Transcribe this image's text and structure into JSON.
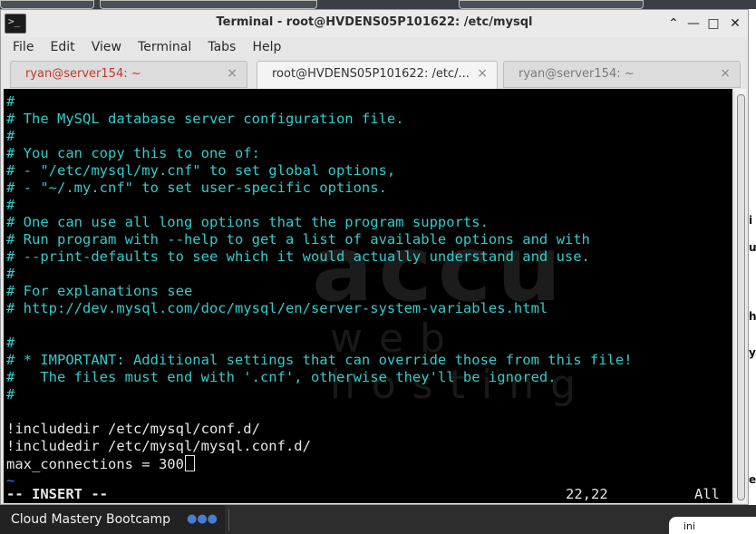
{
  "window": {
    "title": "Terminal - root@HVDENS05P101622: /etc/mysql",
    "menu": [
      "File",
      "Edit",
      "View",
      "Terminal",
      "Tabs",
      "Help"
    ],
    "tabs": [
      {
        "label": "ryan@server154: ~",
        "active": false,
        "color": "#c0392b"
      },
      {
        "label": "root@HVDENS05P101622: /etc/...",
        "active": true,
        "color": "#333333"
      },
      {
        "label": "ryan@server154: ~",
        "active": false,
        "color": "#7a7a7a"
      }
    ]
  },
  "terminal": {
    "watermark_text": "accu",
    "watermark_sub": "web hosting",
    "lines": [
      {
        "text": "#",
        "kind": "comment"
      },
      {
        "text": "# The MySQL database server configuration file.",
        "kind": "comment"
      },
      {
        "text": "#",
        "kind": "comment"
      },
      {
        "text": "# You can copy this to one of:",
        "kind": "comment"
      },
      {
        "text": "# - \"/etc/mysql/my.cnf\" to set global options,",
        "kind": "comment"
      },
      {
        "text": "# - \"~/.my.cnf\" to set user-specific options.",
        "kind": "comment"
      },
      {
        "text": "#",
        "kind": "comment"
      },
      {
        "text": "# One can use all long options that the program supports.",
        "kind": "comment"
      },
      {
        "text": "# Run program with --help to get a list of available options and with",
        "kind": "comment"
      },
      {
        "text": "# --print-defaults to see which it would actually understand and use.",
        "kind": "comment"
      },
      {
        "text": "#",
        "kind": "comment"
      },
      {
        "text": "# For explanations see",
        "kind": "comment"
      },
      {
        "text": "# http://dev.mysql.com/doc/mysql/en/server-system-variables.html",
        "kind": "comment"
      },
      {
        "text": "",
        "kind": "blank"
      },
      {
        "text": "#",
        "kind": "comment"
      },
      {
        "text": "# * IMPORTANT: Additional settings that can override those from this file!",
        "kind": "comment"
      },
      {
        "text": "#   The files must end with '.cnf', otherwise they'll be ignored.",
        "kind": "comment"
      },
      {
        "text": "#",
        "kind": "comment"
      },
      {
        "text": "",
        "kind": "blank"
      },
      {
        "text": "!includedir /etc/mysql/conf.d/",
        "kind": "plain"
      },
      {
        "text": "!includedir /etc/mysql/mysql.conf.d/",
        "kind": "plain"
      },
      {
        "text": "max_connections = 300",
        "kind": "cursor"
      },
      {
        "text": "~",
        "kind": "tilde"
      }
    ],
    "status": {
      "mode": "-- INSERT --",
      "position": "22,22",
      "scroll": "All"
    }
  },
  "taskbar": {
    "item_label": "Cloud Mastery Bootcamp",
    "item_icon": "dots-icon",
    "popup_text": "ini"
  }
}
